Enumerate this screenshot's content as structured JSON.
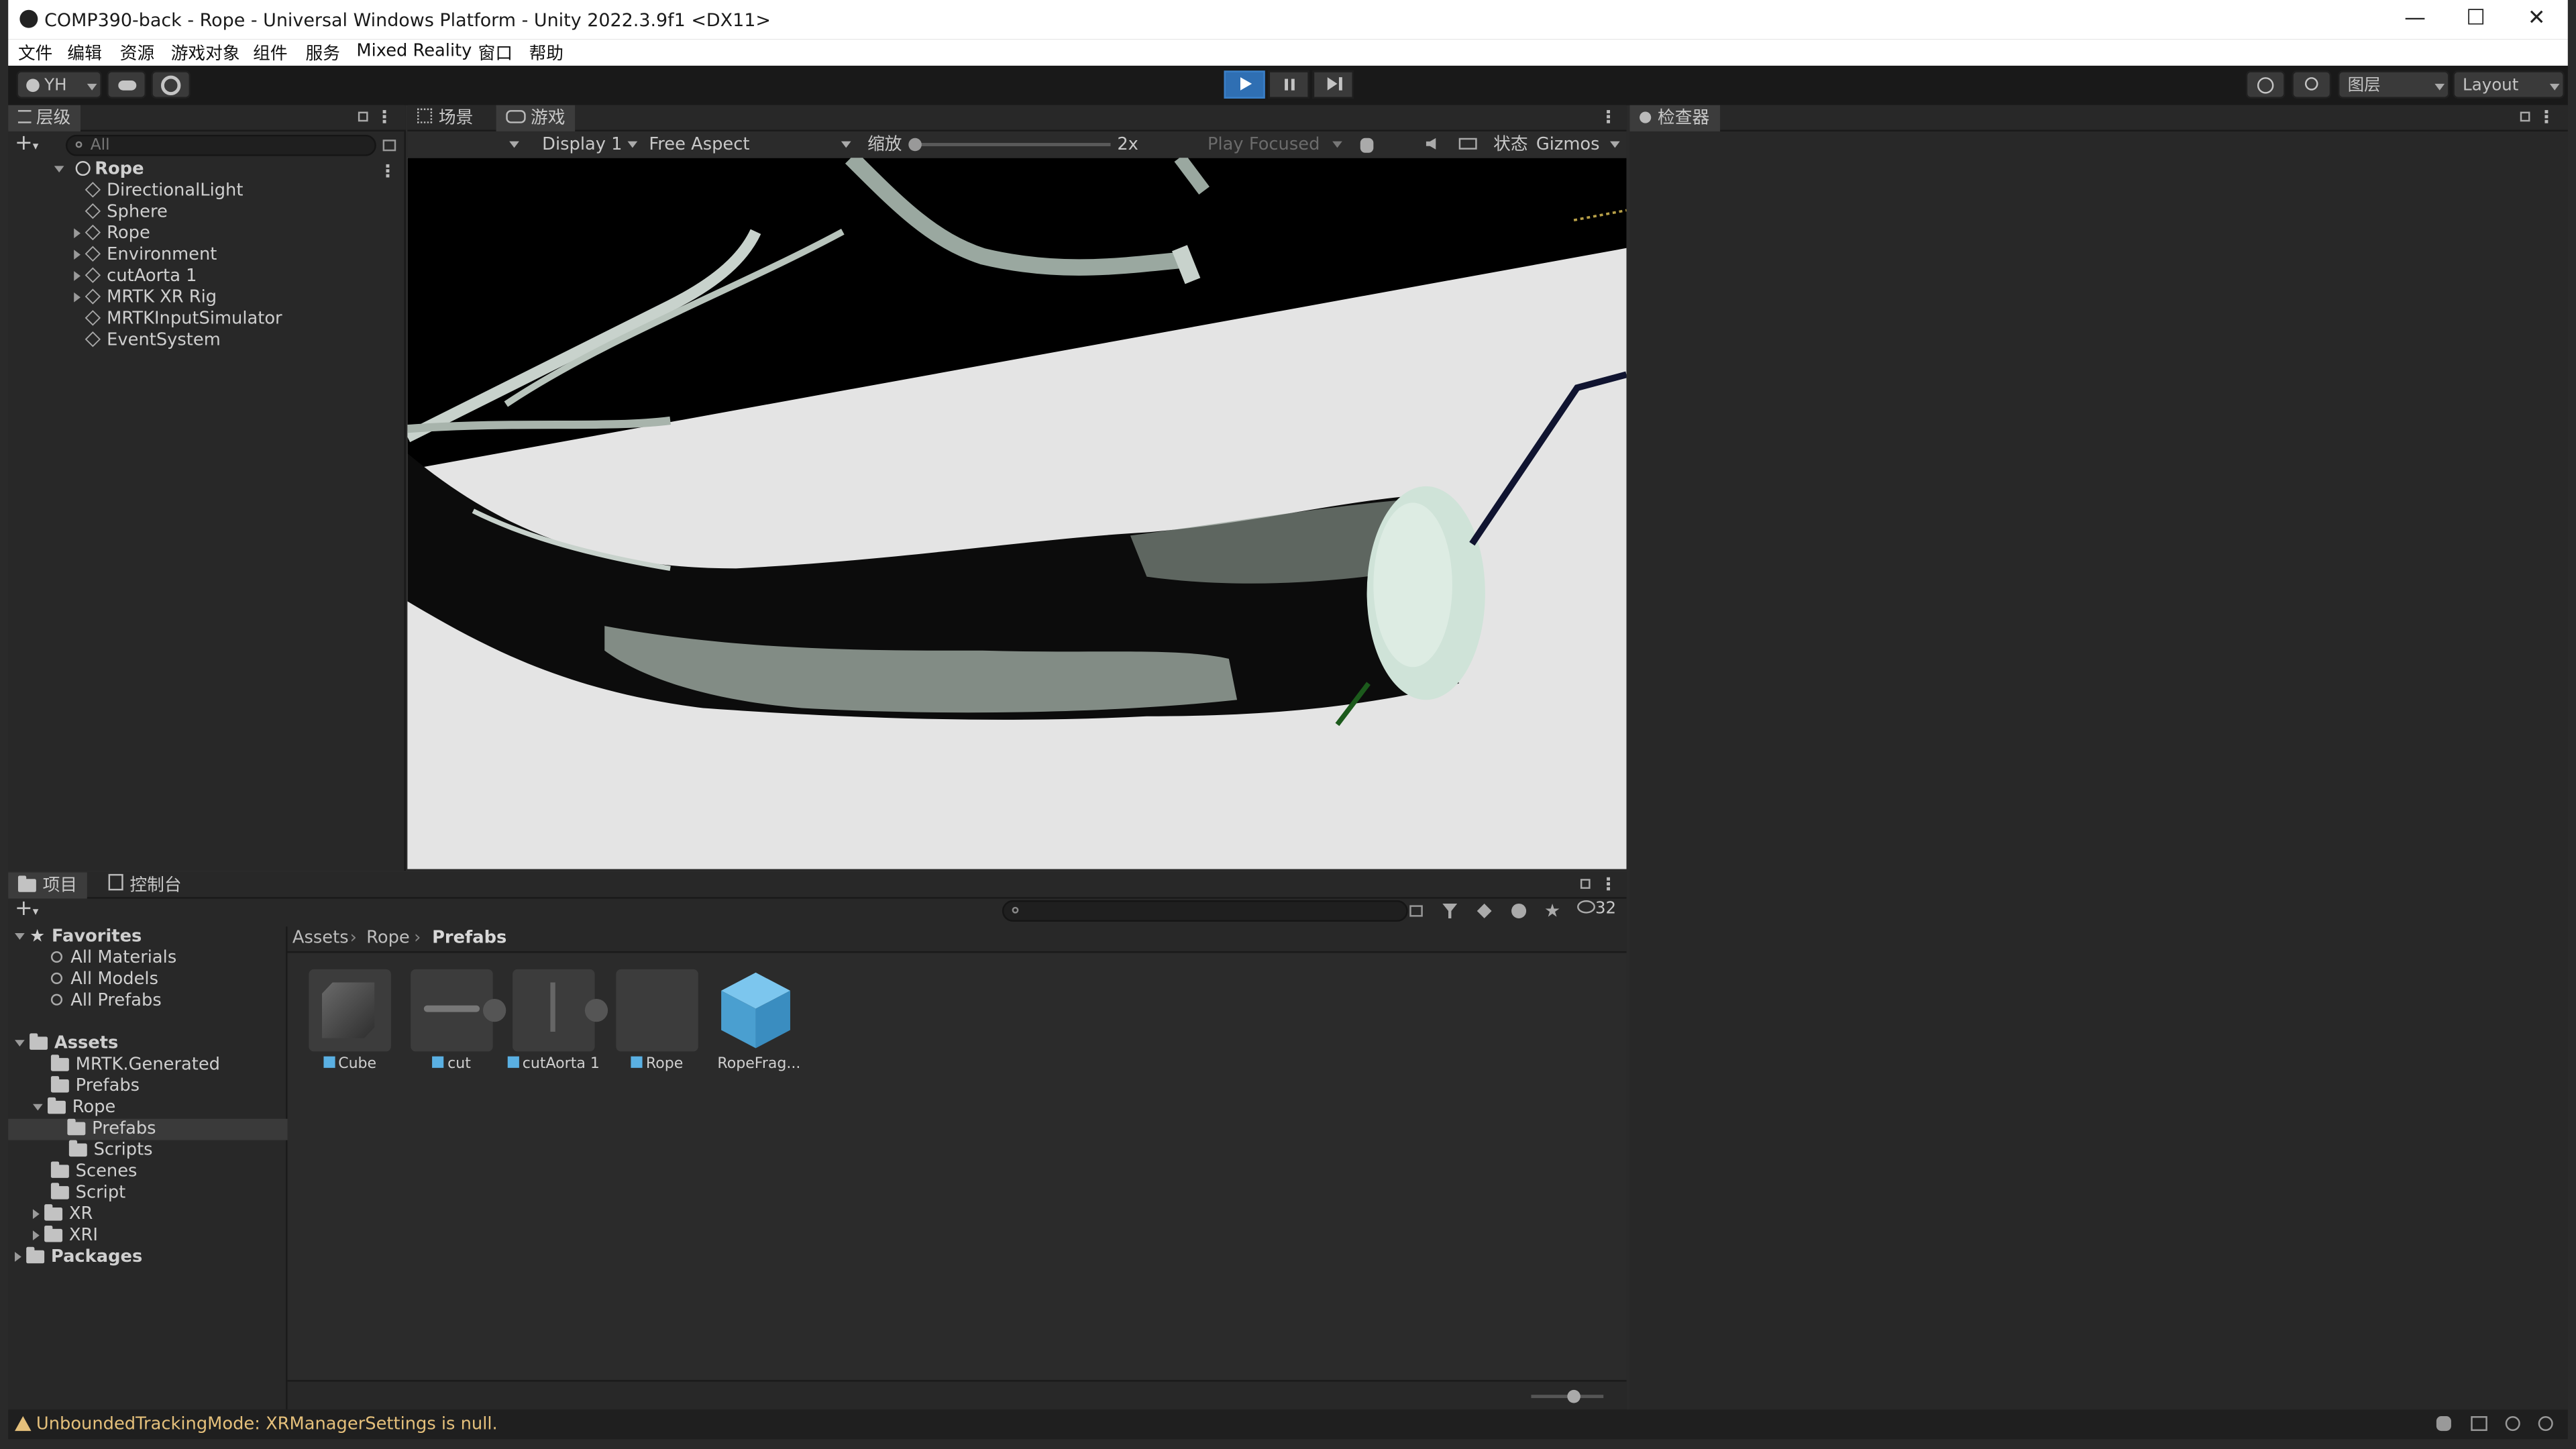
{
  "window": {
    "title": "COMP390-back - Rope - Universal Windows Platform - Unity 2022.3.9f1 <DX11>",
    "minimize": "—",
    "maximize": "☐",
    "close": "✕"
  },
  "menu": [
    "文件",
    "编辑",
    "资源",
    "游戏对象",
    "组件",
    "服务",
    "Mixed Reality",
    "窗口",
    "帮助"
  ],
  "toolbar": {
    "account": "YH",
    "layers": "图层",
    "layout": "Layout"
  },
  "hierarchy": {
    "tab": "层级",
    "search_placeholder": "All",
    "root": "Rope",
    "items": [
      {
        "label": "DirectionalLight",
        "expandable": false
      },
      {
        "label": "Sphere",
        "expandable": false
      },
      {
        "label": "Rope",
        "expandable": true
      },
      {
        "label": "Environment",
        "expandable": true
      },
      {
        "label": "cutAorta 1",
        "expandable": true
      },
      {
        "label": "MRTK XR Rig",
        "expandable": true
      },
      {
        "label": "MRTKInputSimulator",
        "expandable": false
      },
      {
        "label": "EventSystem",
        "expandable": false
      }
    ]
  },
  "scene_tabs": {
    "scene": "场景",
    "game": "游戏"
  },
  "game_toolbar": {
    "display": "Display 1",
    "aspect": "Free Aspect",
    "scale_label": "缩放",
    "scale_value": "2x",
    "play_mode": "Play Focused",
    "stats": "状态",
    "gizmos": "Gizmos"
  },
  "inspector": {
    "tab": "检查器"
  },
  "project": {
    "tab_project": "项目",
    "tab_console": "控制台",
    "hidden_count": "32",
    "breadcrumb": [
      "Assets",
      "Rope",
      "Prefabs"
    ],
    "favorites": {
      "label": "Favorites",
      "items": [
        "All Materials",
        "All Models",
        "All Prefabs"
      ]
    },
    "assets_tree": {
      "label": "Assets",
      "items": [
        {
          "label": "MRTK.Generated",
          "depth": 1,
          "state": "none"
        },
        {
          "label": "Prefabs",
          "depth": 1,
          "state": "none"
        },
        {
          "label": "Rope",
          "depth": 1,
          "state": "open"
        },
        {
          "label": "Prefabs",
          "depth": 2,
          "state": "selected"
        },
        {
          "label": "Scripts",
          "depth": 2,
          "state": "none"
        },
        {
          "label": "Scenes",
          "depth": 1,
          "state": "none"
        },
        {
          "label": "Script",
          "depth": 1,
          "state": "none"
        },
        {
          "label": "XR",
          "depth": 1,
          "state": "closed"
        },
        {
          "label": "XRI",
          "depth": 1,
          "state": "closed"
        }
      ],
      "packages": "Packages"
    },
    "assets": [
      "Cube",
      "cut",
      "cutAorta 1",
      "Rope",
      "RopeFrag..."
    ]
  },
  "status_bar": {
    "message": "UnboundedTrackingMode: XRManagerSettings is null."
  },
  "colors": {
    "accent": "#2f6fb3",
    "warning": "#e5c07b",
    "prefab_cube": "#5ab0e3"
  }
}
